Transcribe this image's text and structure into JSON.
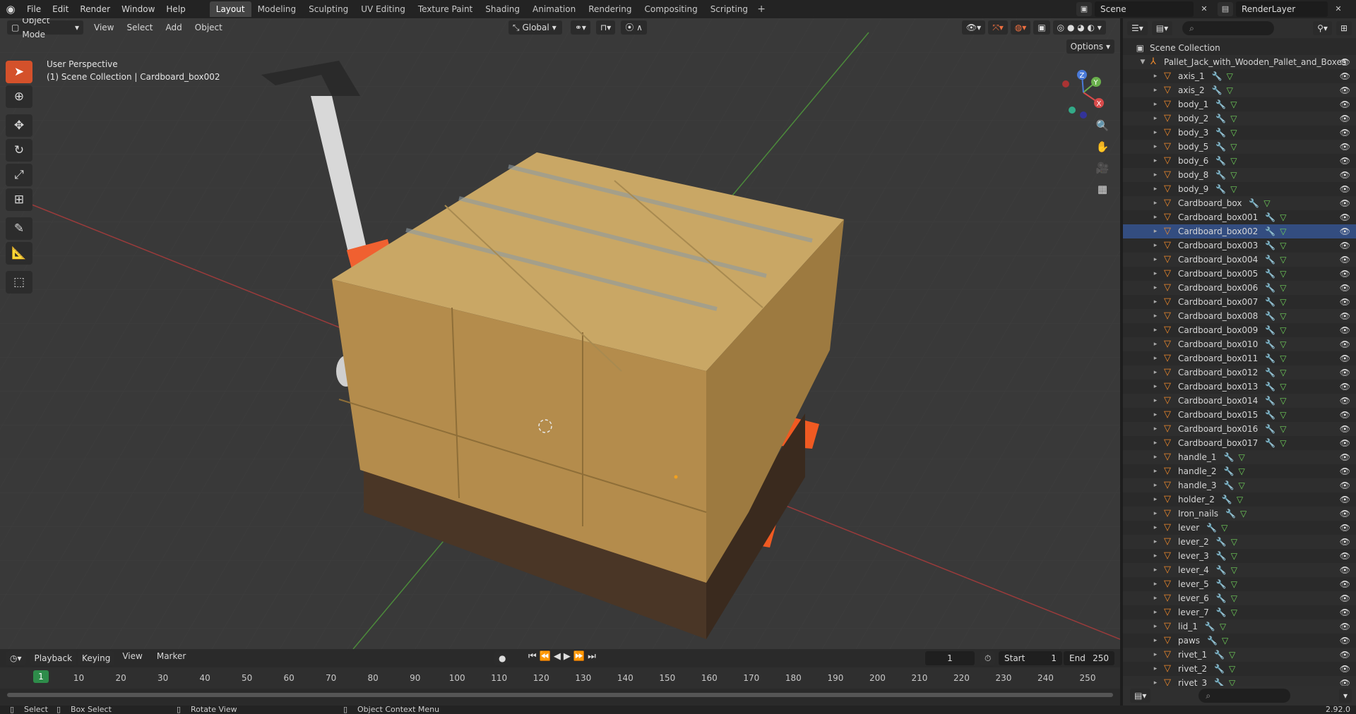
{
  "menu": [
    "File",
    "Edit",
    "Render",
    "Window",
    "Help"
  ],
  "workspaces": [
    {
      "label": "Layout",
      "active": true
    },
    {
      "label": "Modeling",
      "active": false
    },
    {
      "label": "Sculpting",
      "active": false
    },
    {
      "label": "UV Editing",
      "active": false
    },
    {
      "label": "Texture Paint",
      "active": false
    },
    {
      "label": "Shading",
      "active": false
    },
    {
      "label": "Animation",
      "active": false
    },
    {
      "label": "Rendering",
      "active": false
    },
    {
      "label": "Compositing",
      "active": false
    },
    {
      "label": "Scripting",
      "active": false
    }
  ],
  "scene_name": "Scene",
  "render_layer": "RenderLayer",
  "viewport": {
    "mode": "Object Mode",
    "menus": [
      "View",
      "Select",
      "Add",
      "Object"
    ],
    "transform_orientation": "Global",
    "options_label": "Options",
    "perspective_label": "User Perspective",
    "context_label": "(1) Scene Collection | Cardboard_box002"
  },
  "gizmo": {
    "x": "X",
    "y": "Y",
    "z": "Z"
  },
  "timeline": {
    "menus": [
      "Playback",
      "Keying",
      "View",
      "Marker"
    ],
    "current_frame": "1",
    "start_label": "Start",
    "start_value": "1",
    "end_label": "End",
    "end_value": "250",
    "ticks": [
      "1",
      "10",
      "20",
      "30",
      "40",
      "50",
      "60",
      "70",
      "80",
      "90",
      "100",
      "110",
      "120",
      "130",
      "140",
      "150",
      "160",
      "170",
      "180",
      "190",
      "200",
      "210",
      "220",
      "230",
      "240",
      "250"
    ]
  },
  "status": {
    "select": "Select",
    "box_select": "Box Select",
    "rotate_view": "Rotate View",
    "context_menu": "Object Context Menu",
    "version": "2.92.0"
  },
  "outliner": {
    "root": "Scene Collection",
    "collection": "Pallet_Jack_with_Wooden_Pallet_and_Boxes",
    "selected": "Cardboard_box002",
    "items": [
      "axis_1",
      "axis_2",
      "body_1",
      "body_2",
      "body_3",
      "body_5",
      "body_6",
      "body_8",
      "body_9",
      "Cardboard_box",
      "Cardboard_box001",
      "Cardboard_box002",
      "Cardboard_box003",
      "Cardboard_box004",
      "Cardboard_box005",
      "Cardboard_box006",
      "Cardboard_box007",
      "Cardboard_box008",
      "Cardboard_box009",
      "Cardboard_box010",
      "Cardboard_box011",
      "Cardboard_box012",
      "Cardboard_box013",
      "Cardboard_box014",
      "Cardboard_box015",
      "Cardboard_box016",
      "Cardboard_box017",
      "handle_1",
      "handle_2",
      "handle_3",
      "holder_2",
      "Iron_nails",
      "lever",
      "lever_2",
      "lever_3",
      "lever_4",
      "lever_5",
      "lever_6",
      "lever_7",
      "lid_1",
      "paws",
      "rivet_1",
      "rivet_2",
      "rivet_3"
    ]
  }
}
